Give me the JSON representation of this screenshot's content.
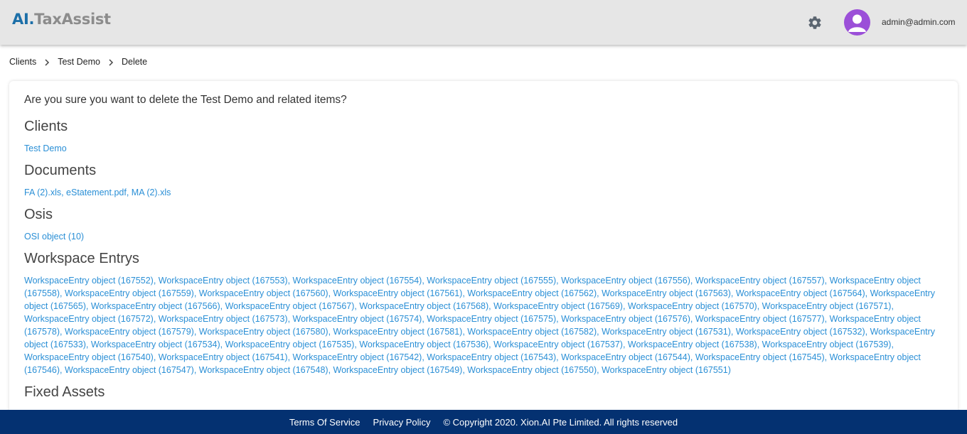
{
  "brand": {
    "logo_ai": "AI.",
    "logo_rest": "TaxAssist"
  },
  "header": {
    "user_email": "admin@admin.com",
    "settings_icon": "gear-icon",
    "avatar_icon": "user-avatar-icon"
  },
  "breadcrumb": {
    "items": [
      "Clients",
      "Test Demo",
      "Delete"
    ]
  },
  "confirm_message": "Are you sure you want to delete the Test Demo and related items?",
  "sections": {
    "clients": {
      "title": "Clients",
      "items": [
        "Test Demo"
      ]
    },
    "documents": {
      "title": "Documents",
      "items": [
        "FA (2).xls",
        "eStatement.pdf",
        "MA (2).xls"
      ]
    },
    "osis": {
      "title": "Osis",
      "items": [
        "OSI object (10)"
      ]
    },
    "workspace_entrys": {
      "title": "Workspace Entrys",
      "items": [
        "WorkspaceEntry object (167552)",
        "WorkspaceEntry object (167553)",
        "WorkspaceEntry object (167554)",
        "WorkspaceEntry object (167555)",
        "WorkspaceEntry object (167556)",
        "WorkspaceEntry object (167557)",
        "WorkspaceEntry object (167558)",
        "WorkspaceEntry object (167559)",
        "WorkspaceEntry object (167560)",
        "WorkspaceEntry object (167561)",
        "WorkspaceEntry object (167562)",
        "WorkspaceEntry object (167563)",
        "WorkspaceEntry object (167564)",
        "WorkspaceEntry object (167565)",
        "WorkspaceEntry object (167566)",
        "WorkspaceEntry object (167567)",
        "WorkspaceEntry object (167568)",
        "WorkspaceEntry object (167569)",
        "WorkspaceEntry object (167570)",
        "WorkspaceEntry object (167571)",
        "WorkspaceEntry object (167572)",
        "WorkspaceEntry object (167573)",
        "WorkspaceEntry object (167574)",
        "WorkspaceEntry object (167575)",
        "WorkspaceEntry object (167576)",
        "WorkspaceEntry object (167577)",
        "WorkspaceEntry object (167578)",
        "WorkspaceEntry object (167579)",
        "WorkspaceEntry object (167580)",
        "WorkspaceEntry object (167581)",
        "WorkspaceEntry object (167582)",
        "WorkspaceEntry object (167531)",
        "WorkspaceEntry object (167532)",
        "WorkspaceEntry object (167533)",
        "WorkspaceEntry object (167534)",
        "WorkspaceEntry object (167535)",
        "WorkspaceEntry object (167536)",
        "WorkspaceEntry object (167537)",
        "WorkspaceEntry object (167538)",
        "WorkspaceEntry object (167539)",
        "WorkspaceEntry object (167540)",
        "WorkspaceEntry object (167541)",
        "WorkspaceEntry object (167542)",
        "WorkspaceEntry object (167543)",
        "WorkspaceEntry object (167544)",
        "WorkspaceEntry object (167545)",
        "WorkspaceEntry object (167546)",
        "WorkspaceEntry object (167547)",
        "WorkspaceEntry object (167548)",
        "WorkspaceEntry object (167549)",
        "WorkspaceEntry object (167550)",
        "WorkspaceEntry object (167551)"
      ]
    },
    "fixed_assets": {
      "title": "Fixed Assets"
    }
  },
  "footer": {
    "terms": "Terms Of Service",
    "privacy": "Privacy Policy",
    "copyright": "© Copyright 2020. Xion.AI Pte Limited. All rights reserved"
  },
  "colors": {
    "link": "#2a8fd6",
    "footer_bg": "#043171",
    "avatar": "#9b4fd8",
    "logo_ai": "#1c6fa8"
  }
}
